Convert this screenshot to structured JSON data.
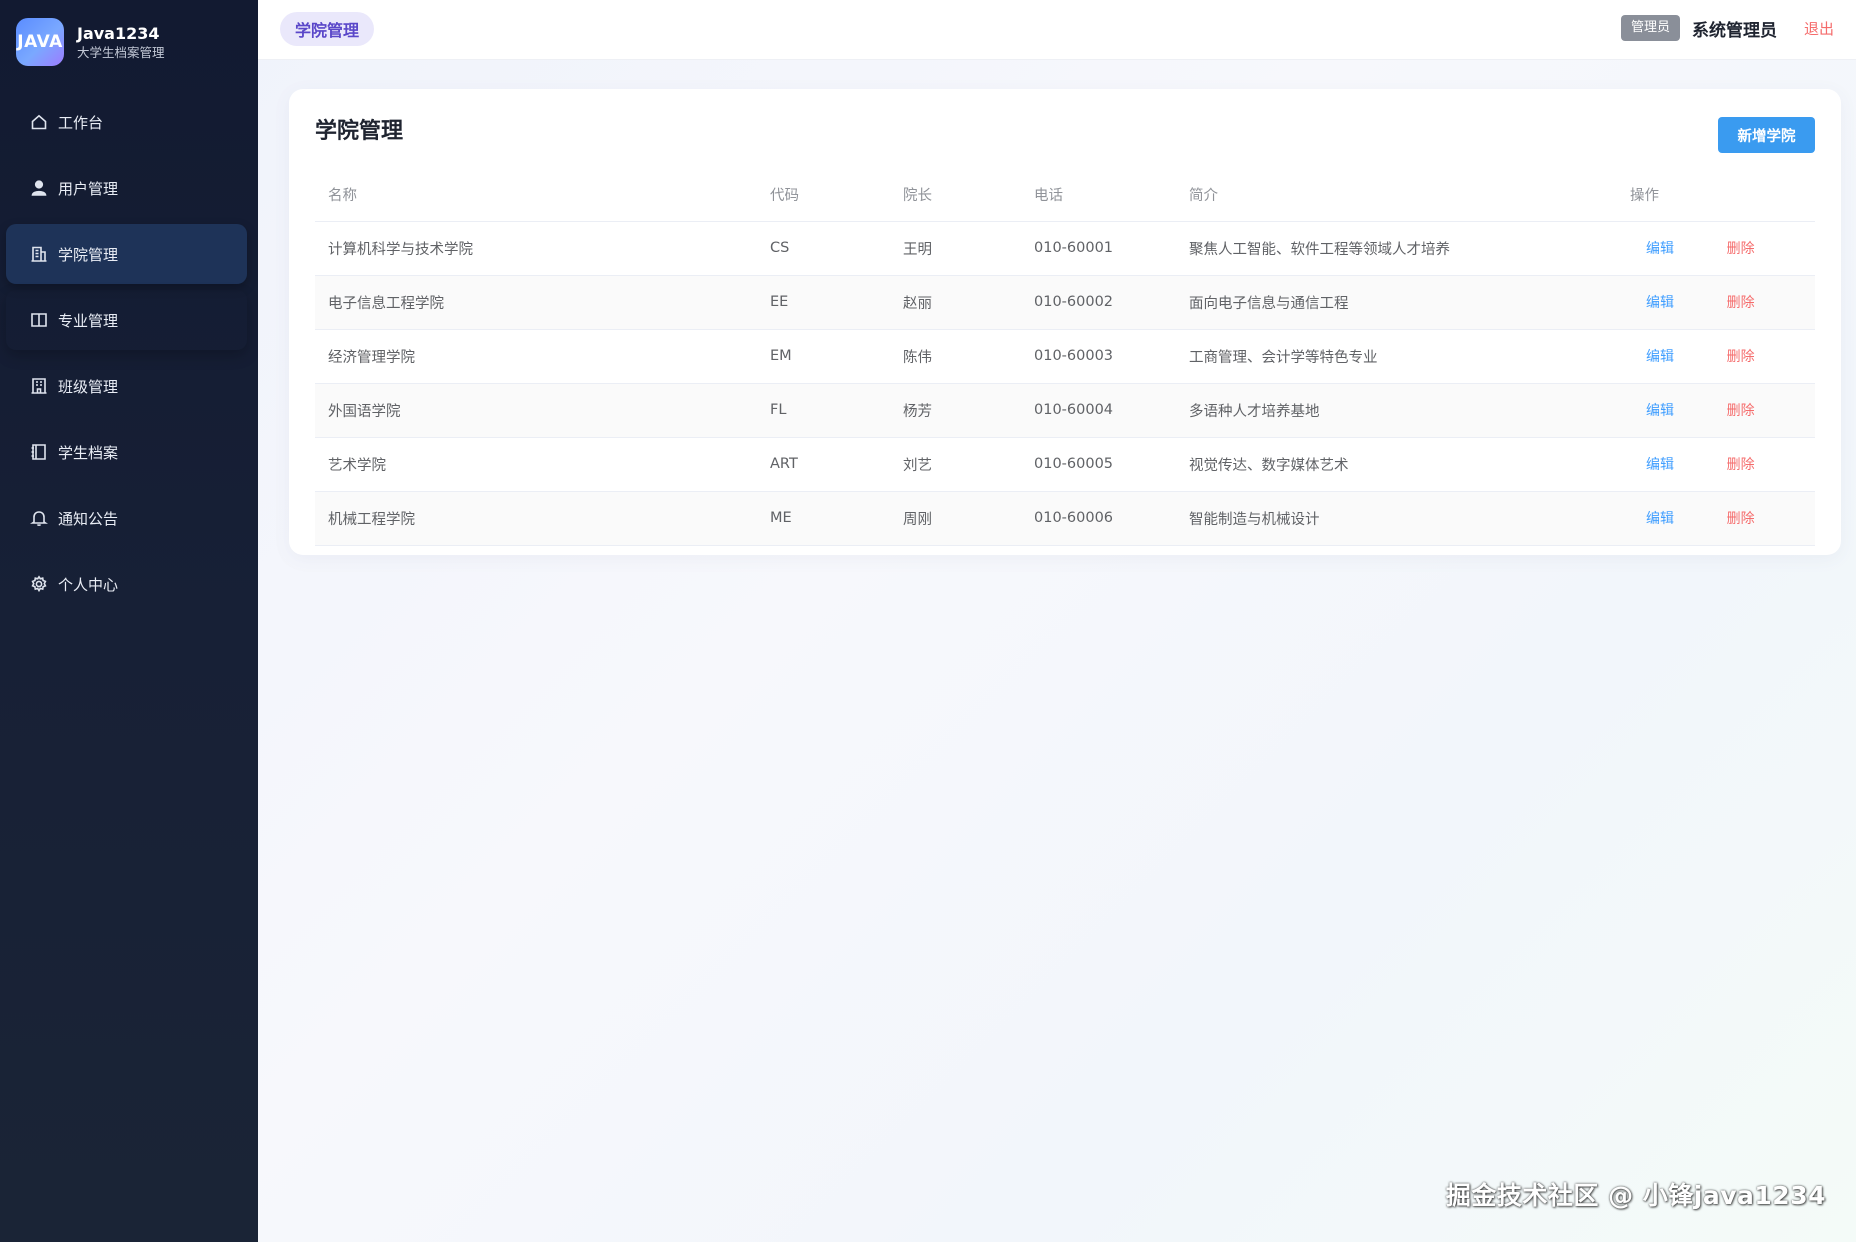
{
  "brand": {
    "logo_text": "JAVA",
    "name": "Java1234",
    "subtitle": "大学生档案管理"
  },
  "sidebar": {
    "items": [
      {
        "label": "工作台",
        "icon": "home-icon",
        "active": false
      },
      {
        "label": "用户管理",
        "icon": "user-icon",
        "active": false
      },
      {
        "label": "学院管理",
        "icon": "building-icon",
        "active": true
      },
      {
        "label": "专业管理",
        "icon": "book-icon",
        "active": false
      },
      {
        "label": "班级管理",
        "icon": "office-icon",
        "active": false
      },
      {
        "label": "学生档案",
        "icon": "notebook-icon",
        "active": false
      },
      {
        "label": "通知公告",
        "icon": "bell-icon",
        "active": false
      },
      {
        "label": "个人中心",
        "icon": "gear-icon",
        "active": false
      }
    ]
  },
  "header": {
    "page_tag": "学院管理",
    "role_badge": "管理员",
    "user_name": "系统管理员",
    "logout": "退出"
  },
  "main": {
    "title": "学院管理",
    "add_button": "新增学院",
    "table": {
      "columns": [
        "名称",
        "代码",
        "院长",
        "电话",
        "简介",
        "操作"
      ],
      "rows": [
        [
          "计算机科学与技术学院",
          "CS",
          "王明",
          "010-60001",
          "聚焦人工智能、软件工程等领域人才培养"
        ],
        [
          "电子信息工程学院",
          "EE",
          "赵丽",
          "010-60002",
          "面向电子信息与通信工程"
        ],
        [
          "经济管理学院",
          "EM",
          "陈伟",
          "010-60003",
          "工商管理、会计学等特色专业"
        ],
        [
          "外国语学院",
          "FL",
          "杨芳",
          "010-60004",
          "多语种人才培养基地"
        ],
        [
          "艺术学院",
          "ART",
          "刘艺",
          "010-60005",
          "视觉传达、数字媒体艺术"
        ],
        [
          "机械工程学院",
          "ME",
          "周刚",
          "010-60006",
          "智能制造与机械设计"
        ]
      ],
      "edit_label": "编辑",
      "delete_label": "删除"
    }
  },
  "watermark": "掘金技术社区 @ 小锋java1234",
  "colors": {
    "sidebar_bg": "#141c33",
    "active_item": "#1e3358",
    "primary": "#3a9bf0",
    "danger": "#f56c6c",
    "tag_text": "#5a47c9"
  }
}
